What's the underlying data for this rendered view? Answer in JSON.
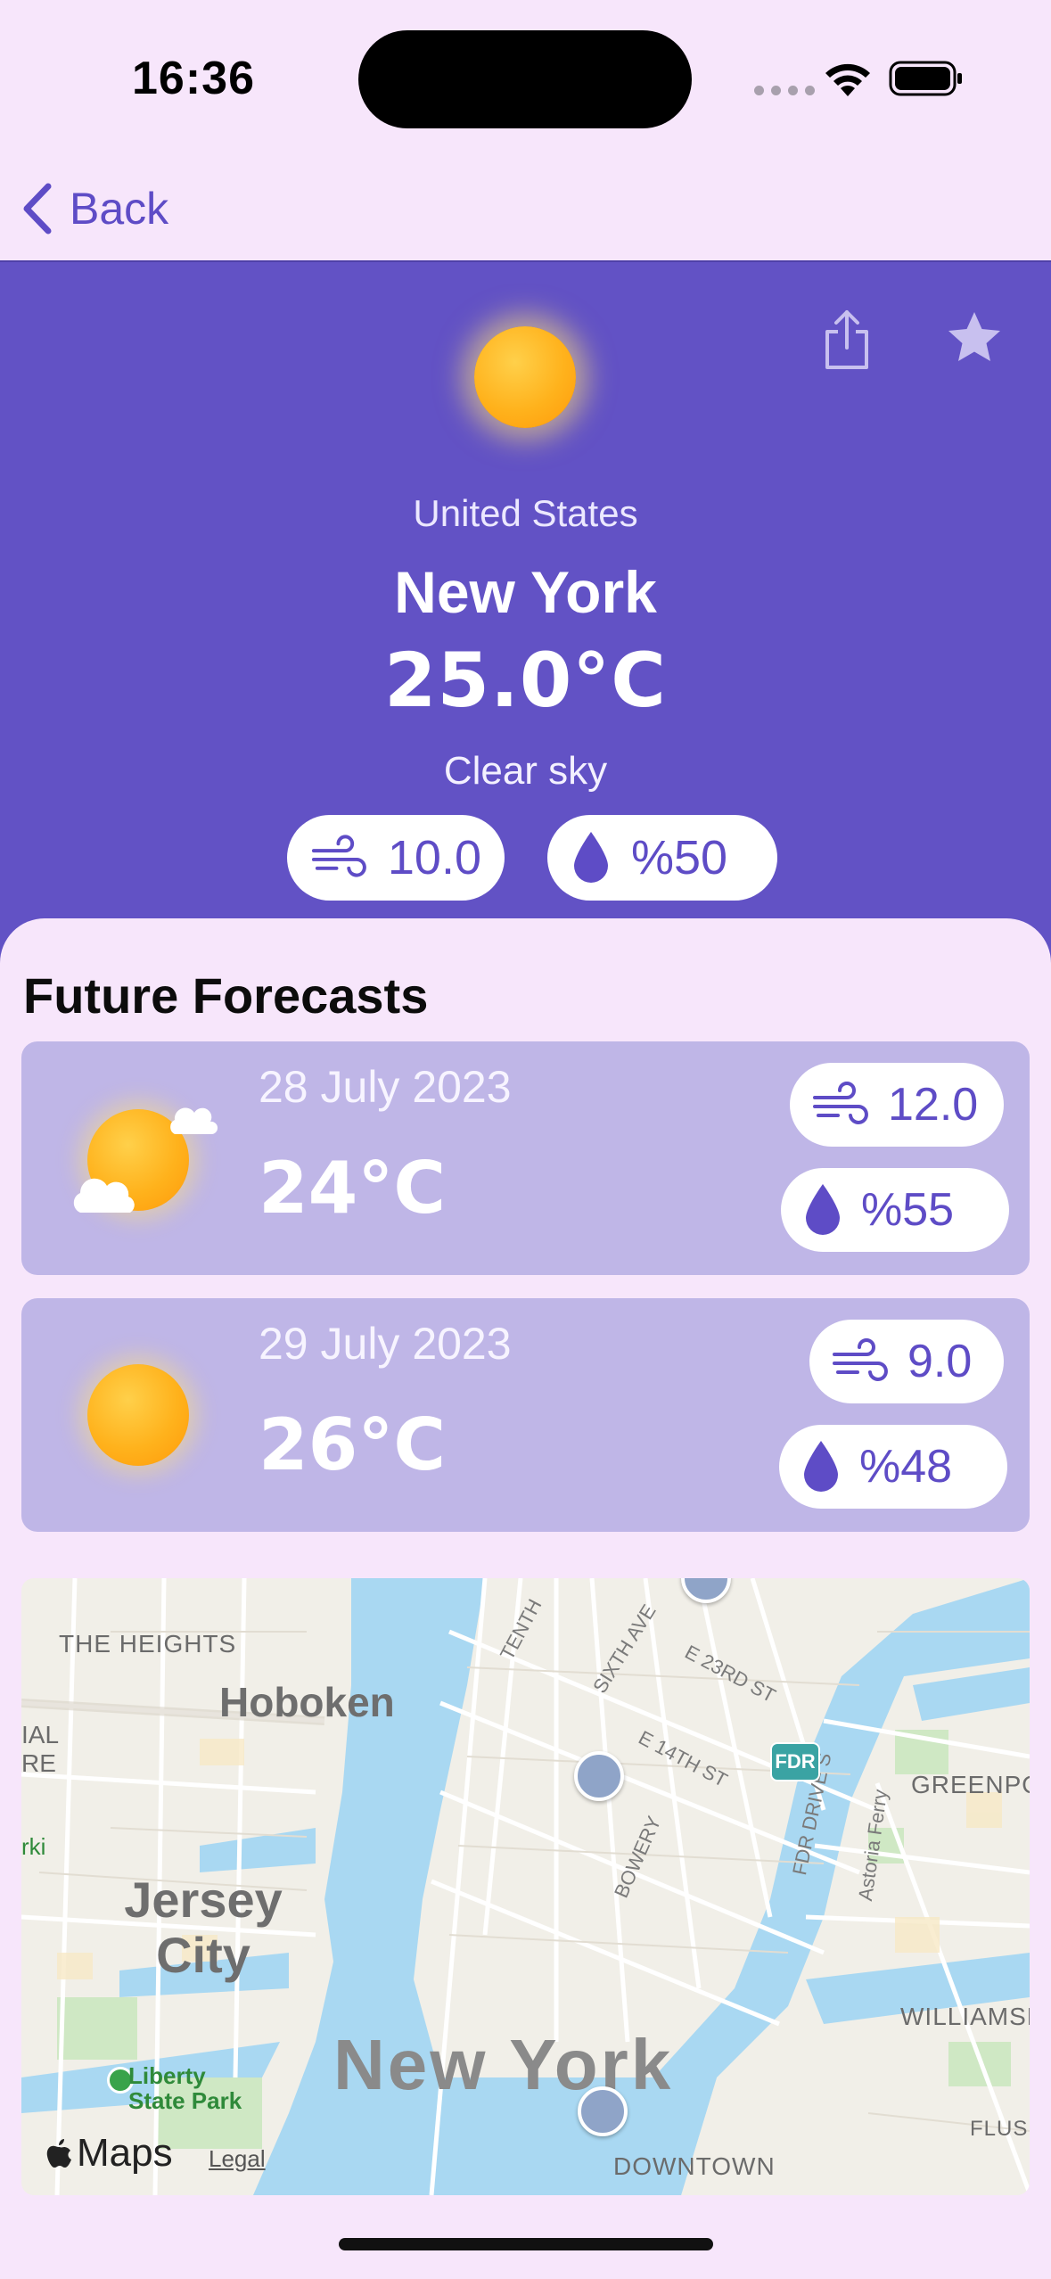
{
  "status_bar": {
    "time": "16:36"
  },
  "nav": {
    "back_label": "Back"
  },
  "current": {
    "country": "United States",
    "city": "New York",
    "temperature": "25.0°C",
    "condition": "Clear sky",
    "wind": "10.0",
    "humidity": "%50",
    "icon": "sun-icon"
  },
  "forecast": {
    "title": "Future Forecasts",
    "items": [
      {
        "date": "28 July 2023",
        "temp": "24°C",
        "wind": "12.0",
        "humidity": "%55",
        "icon": "partly-cloudy-icon"
      },
      {
        "date": "29 July 2023",
        "temp": "26°C",
        "wind": "9.0",
        "humidity": "%48",
        "icon": "sun-icon"
      }
    ]
  },
  "map": {
    "labels": {
      "heights": "THE HEIGHTS",
      "hoboken": "Hoboken",
      "jersey_city": "Jersey City",
      "new_york": "New York",
      "greenpoint": "GREENPOI",
      "williamsburg": "WILLIAMSE",
      "downtown": "DOWNTOWN",
      "nal": "IAL\nRE",
      "rki": "rki",
      "flus": "FLUS",
      "sixth_ave": "SIXTH AVE",
      "tenth": "TENTH",
      "e23rd": "E 23RD ST",
      "e14th": "E 14TH ST",
      "bowery": "BOWERY",
      "fdr_drive": "FDR DRIVE S",
      "astoria_ferry": "Astoria Ferry",
      "liberty_park": "Liberty\nState Park",
      "fdr_badge": "FDR"
    },
    "attribution": {
      "maps": "Maps",
      "legal": "Legal"
    }
  },
  "colors": {
    "accent": "#6252c5",
    "background": "#f7e6fb",
    "card": "#bfb6e7",
    "sun": "#ffb21c"
  }
}
